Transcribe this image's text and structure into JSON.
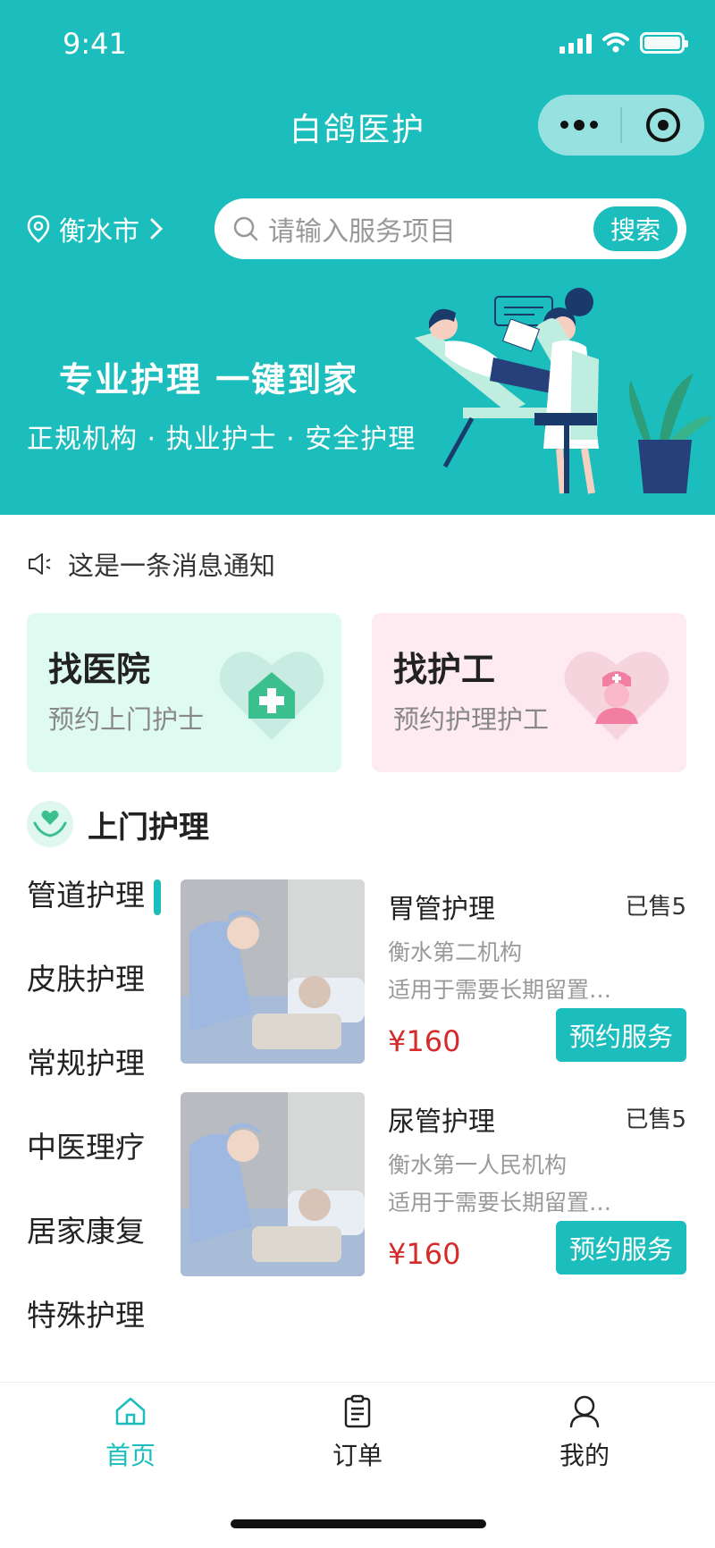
{
  "status_bar": {
    "time": "9:41"
  },
  "nav": {
    "title": "白鸽医护"
  },
  "location": {
    "city": "衡水市"
  },
  "search": {
    "placeholder": "请输入服务项目",
    "button_label": "搜索"
  },
  "banner": {
    "title": "专业护理 一键到家",
    "subtitle": "正规机构 · 执业护士 · 安全护理"
  },
  "notice": {
    "text": "这是一条消息通知"
  },
  "quick_cards": [
    {
      "title": "找医院",
      "subtitle": "预约上门护士",
      "icon": "hospital-heart-icon"
    },
    {
      "title": "找护工",
      "subtitle": "预约护理护工",
      "icon": "nurse-heart-icon"
    }
  ],
  "section": {
    "title": "上门护理",
    "icon": "care-hands-icon"
  },
  "categories": [
    {
      "label": "管道护理",
      "active": true
    },
    {
      "label": "皮肤护理",
      "active": false
    },
    {
      "label": "常规护理",
      "active": false
    },
    {
      "label": "中医理疗",
      "active": false
    },
    {
      "label": "居家康复",
      "active": false
    },
    {
      "label": "特殊护理",
      "active": false
    }
  ],
  "services": [
    {
      "name": "胃管护理",
      "sold": "已售5",
      "org": "衡水第二机构",
      "desc": "适用于需要长期留置胃管的患者",
      "price": "¥160",
      "button": "预约服务"
    },
    {
      "name": "尿管护理",
      "sold": "已售5",
      "org": "衡水第一人民机构",
      "desc": "适用于需要长期留置尿管的患者",
      "price": "¥160",
      "button": "预约服务"
    }
  ],
  "tabbar": [
    {
      "label": "首页",
      "icon": "home-icon",
      "active": true
    },
    {
      "label": "订单",
      "icon": "clipboard-icon",
      "active": false
    },
    {
      "label": "我的",
      "icon": "user-icon",
      "active": false
    }
  ],
  "colors": {
    "brand": "#1cbdbd",
    "price": "#d62b2b",
    "hospital_card": "#dffaf1",
    "carer_card": "#fdebf1"
  }
}
